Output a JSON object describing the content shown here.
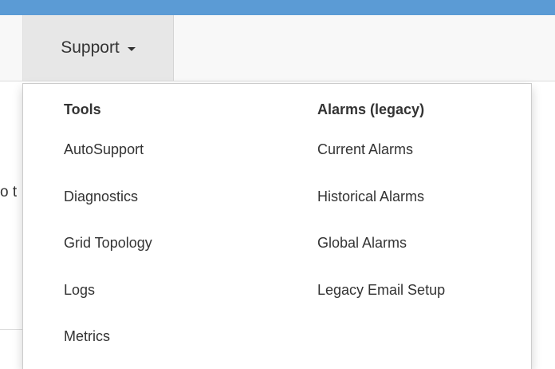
{
  "nav": {
    "support_label": "Support"
  },
  "background": {
    "partial_text": "o t"
  },
  "dropdown": {
    "tools": {
      "header": "Tools",
      "items": [
        "AutoSupport",
        "Diagnostics",
        "Grid Topology",
        "Logs",
        "Metrics"
      ]
    },
    "alarms": {
      "header": "Alarms (legacy)",
      "items": [
        "Current Alarms",
        "Historical Alarms",
        "Global Alarms",
        "Legacy Email Setup"
      ]
    }
  },
  "colors": {
    "top_strip": "#5b9bd5",
    "nav_active": "#e7e7e7",
    "text": "#333333"
  }
}
